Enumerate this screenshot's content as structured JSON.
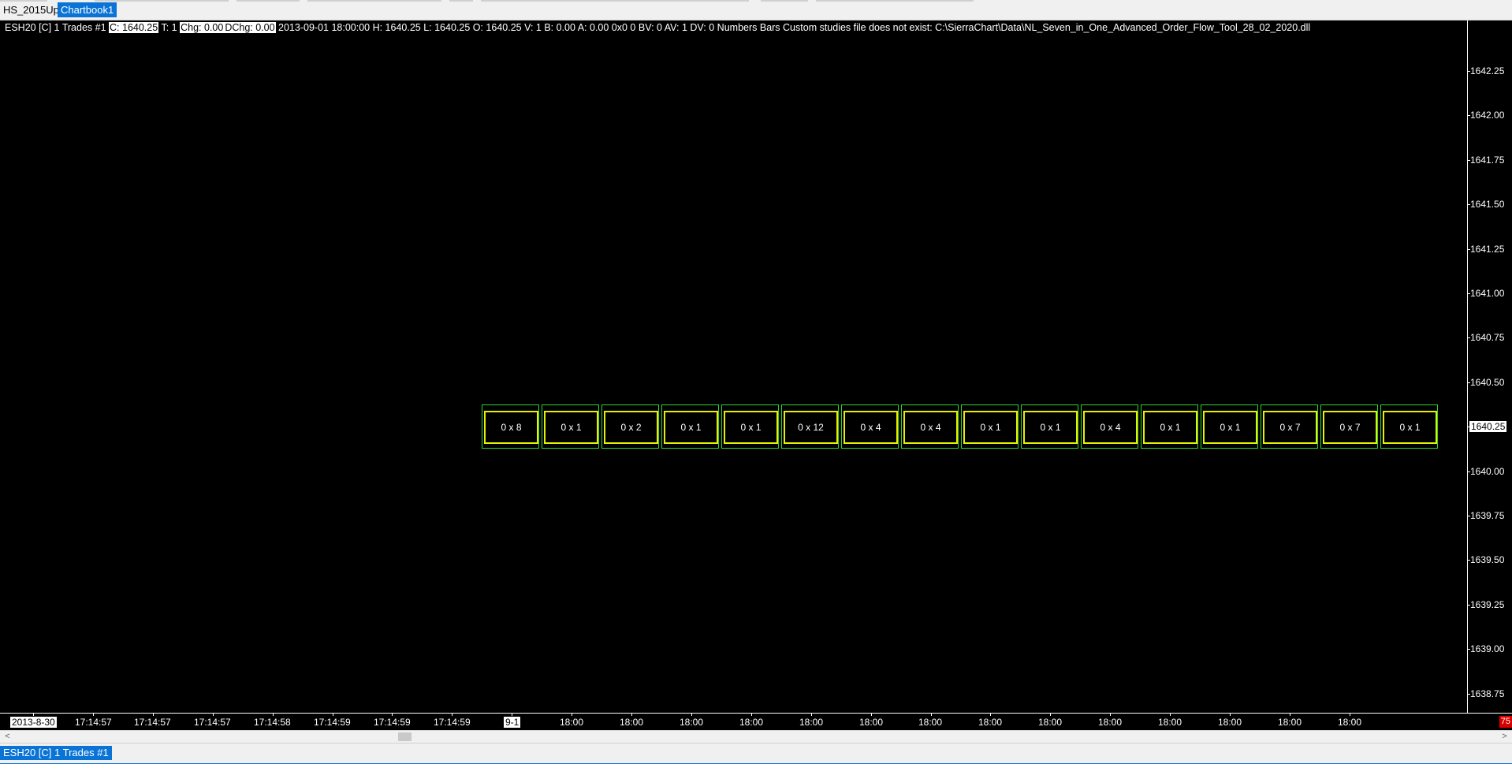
{
  "chartbook_tabs": [
    "HS_2015Up",
    "Chartbook1"
  ],
  "header": {
    "symbol": "ESH20 [C]  1 Trades  #1",
    "close": "C: 1640.25",
    "trades_prefix": "T: 1",
    "chg": "Chg: 0.00",
    "dchg": "DChg: 0.00",
    "info": "2013-09-01 18:00:00 H: 1640.25 L: 1640.25 O: 1640.25 V: 1 B: 0.00 A: 0.00 0x0 0 BV: 0 AV: 1 DV: 0 Numbers Bars  Custom studies file does not exist: C:\\SierraChart\\Data\\NL_Seven_in_One_Advanced_Order_Flow_Tool_28_02_2020.dll"
  },
  "price_axis": {
    "labels": [
      "1642.25",
      "1642.00",
      "1641.75",
      "1641.50",
      "1641.25",
      "1641.00",
      "1640.75",
      "1640.50",
      "1640.25",
      "1640.00",
      "1639.75",
      "1639.50",
      "1639.25",
      "1639.00",
      "1638.75"
    ],
    "current_price": "1640.25"
  },
  "numbers_bars": {
    "cells": [
      "0 x 8",
      "0 x 1",
      "0 x 2",
      "0 x 1",
      "0 x 1",
      "0 x 12",
      "0 x 4",
      "0 x 4",
      "0 x 1",
      "0 x 1",
      "0 x 4",
      "0 x 1",
      "0 x 1",
      "0 x 7",
      "0 x 7",
      "0 x 1"
    ],
    "outer_color": "#2fd42f",
    "cell_color": "#e8f000"
  },
  "time_axis": {
    "labels": [
      "2013-8-30",
      "17:14:57",
      "17:14:57",
      "17:14:57",
      "17:14:58",
      "17:14:59",
      "17:14:59",
      "17:14:59",
      "9-1",
      "18:00",
      "18:00",
      "18:00",
      "18:00",
      "18:00",
      "18:00",
      "18:00",
      "18:00",
      "18:00",
      "18:00",
      "18:00",
      "18:00",
      "18:00",
      "18:00"
    ],
    "highlighted": [
      "2013-8-30",
      "9-1"
    ]
  },
  "corner_badge": "75",
  "chart_tab": "ESH20 [C]  1 Trades  #1",
  "scrollbar": {
    "left_arrow": "<",
    "right_arrow": ">"
  }
}
